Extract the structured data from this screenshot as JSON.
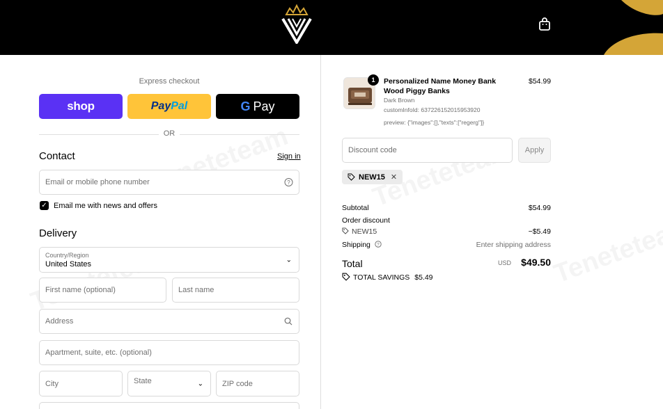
{
  "header": {
    "logo": "crown-v-logo-icon",
    "cart_icon": "shopping-bag-icon"
  },
  "express": {
    "title": "Express checkout",
    "shop_label": "shop",
    "paypal_label_1": "Pay",
    "paypal_label_2": "Pal",
    "gpay_g": "G",
    "gpay_label": "Pay",
    "or": "OR"
  },
  "contact": {
    "heading": "Contact",
    "sign_in": "Sign in",
    "email_placeholder": "Email or mobile phone number",
    "newsletter_label": "Email me with news and offers",
    "newsletter_checked": true
  },
  "delivery": {
    "heading": "Delivery",
    "country_label": "Country/Region",
    "country_value": "United States",
    "first_name_placeholder": "First name (optional)",
    "last_name_placeholder": "Last name",
    "address_placeholder": "Address",
    "apartment_placeholder": "Apartment, suite, etc. (optional)",
    "city_placeholder": "City",
    "state_placeholder": "State",
    "zip_placeholder": "ZIP code"
  },
  "order": {
    "quantity_badge": "1",
    "product_name": "Personalized Name Money Bank Wood Piggy Banks",
    "product_price": "$54.99",
    "variant": "Dark Brown",
    "custom_info": "customInfoId: 637226152015953920",
    "preview": "preview: {\"images\":[],\"texts\":[\"regerg\"]}",
    "discount_placeholder": "Discount code",
    "apply_label": "Apply",
    "applied_code": "NEW15",
    "subtotal_label": "Subtotal",
    "subtotal_value": "$54.99",
    "order_discount_label": "Order discount",
    "discount_code": "NEW15",
    "discount_value": "−$5.49",
    "shipping_label": "Shipping",
    "shipping_value": "Enter shipping address",
    "total_label": "Total",
    "currency": "USD",
    "total_value": "$49.50",
    "savings_label": "TOTAL SAVINGS",
    "savings_value": "$5.49"
  },
  "watermark": "Teneteteam",
  "colors": {
    "shop": "#5a31f4",
    "paypal": "#ffc439",
    "gpay": "#000000",
    "header": "#000000"
  }
}
